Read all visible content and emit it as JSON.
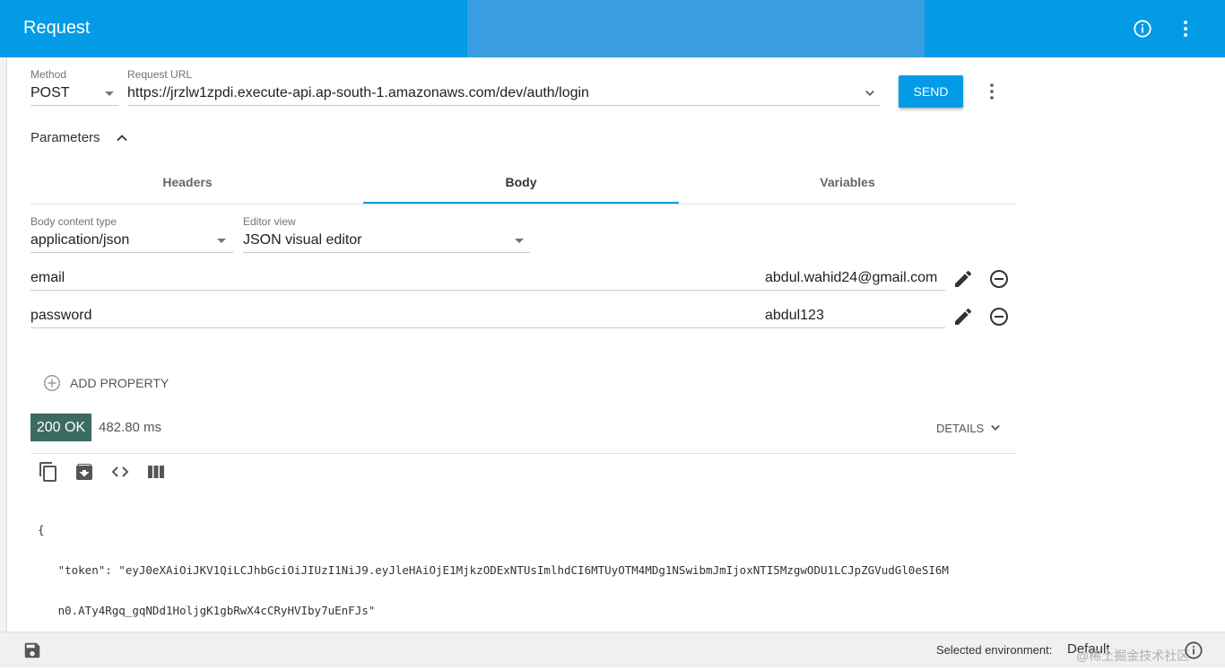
{
  "appbar": {
    "title": "Request"
  },
  "request": {
    "method_label": "Method",
    "method_value": "POST",
    "url_label": "Request URL",
    "url_value": "https://jrzlw1zpdi.execute-api.ap-south-1.amazonaws.com/dev/auth/login",
    "send_label": "SEND"
  },
  "parameters": {
    "label": "Parameters"
  },
  "tabs": [
    {
      "label": "Headers"
    },
    {
      "label": "Body"
    },
    {
      "label": "Variables"
    }
  ],
  "body": {
    "content_type_label": "Body content type",
    "content_type_value": "application/json",
    "editor_view_label": "Editor view",
    "editor_view_value": "JSON visual editor",
    "properties": [
      {
        "name": "email",
        "value": "abdul.wahid24@gmail.com"
      },
      {
        "name": "password",
        "value": "abdul123"
      }
    ],
    "add_property_label": "ADD PROPERTY"
  },
  "response": {
    "status": "200 OK",
    "time": "482.80 ms",
    "details_label": "DETAILS",
    "code_lines": [
      "{",
      "   \"token\": \"eyJ0eXAiOiJKV1QiLCJhbGciOiJIUzI1NiJ9.eyJleHAiOjE1MjkzODExNTUsImlhdCI6MTUyOTM4MDg1NSwibmJmIjoxNTI5MzgwODU1LCJpZGVudGl0eSI6M",
      "   n0.ATy4Rgq_gqNDd1HoljgK1gbRwX4cCRyHVIby7uEnFJs\"",
      "}"
    ]
  },
  "footer": {
    "env_label": "Selected environment:",
    "env_value": "Default",
    "watermark": "@稀土掘金技术社区"
  },
  "colors": {
    "primary": "#039be5",
    "status_ok": "#3c6b62"
  }
}
